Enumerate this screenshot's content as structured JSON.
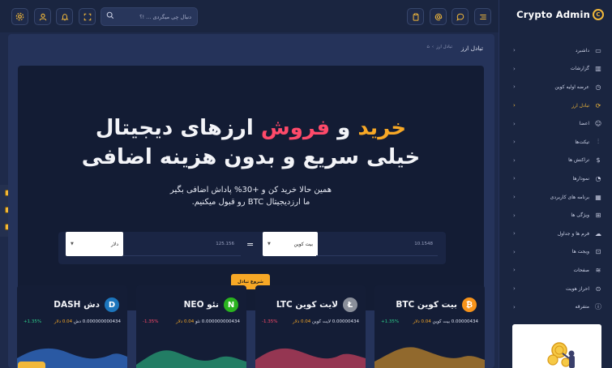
{
  "search": {
    "placeholder": "دنبال چی میگردی ... !؟"
  },
  "brand": {
    "name": "Crypto Admin",
    "logo_letter": "C"
  },
  "nav": [
    {
      "label": "داشبرد",
      "icon": "monitor-icon"
    },
    {
      "label": "گزارشات",
      "icon": "chart-icon"
    },
    {
      "label": "عرضه اولیه کوین",
      "icon": "clock-icon"
    },
    {
      "label": "تبادل ارز",
      "icon": "refresh-icon",
      "active": true
    },
    {
      "label": "اعضا",
      "icon": "users-icon"
    },
    {
      "label": "تیکت‌ها",
      "icon": "tune-icon"
    },
    {
      "label": "تراکنش ها",
      "icon": "dollar-icon"
    },
    {
      "label": "نمودارها",
      "icon": "pie-icon"
    },
    {
      "label": "برنامه های کاربردی",
      "icon": "grid-icon"
    },
    {
      "label": "ویژگی ها",
      "icon": "gift-icon"
    },
    {
      "label": "فرم ها و جداول",
      "icon": "cloud-icon"
    },
    {
      "label": "ویجت ها",
      "icon": "cast-icon"
    },
    {
      "label": "صفحات",
      "icon": "layers-icon"
    },
    {
      "label": "احراز هویت",
      "icon": "lock-icon"
    },
    {
      "label": "متفرقه",
      "icon": "info-icon"
    }
  ],
  "page": {
    "title": "تبادل ارز",
    "breadcrumb_current": "تبادل ارز"
  },
  "hero": {
    "buy": "خرید",
    "and": "و",
    "sell": "فروش",
    "line1_rest": "ارزهای دیجیتال",
    "line2": "خیلی سریع و بدون هزینه اضافی",
    "sub1": "همین حالا خرید کن و +30% پاداش اضافی بگیر",
    "sub2": "ما ارزدیجیتال BTC رو قبول میکنیم."
  },
  "converter": {
    "from_amount": "10.1548",
    "from_currency": "بیت کوین",
    "equals": "=",
    "to_amount": "125.156",
    "to_currency": "دلار",
    "start_label": "شروع تبادل"
  },
  "coins": [
    {
      "name": "بیت کوین BTC",
      "symbol": "₿",
      "color": "#f7931a",
      "amount_text": "0.00000434 بیت کوین",
      "usd_text": "0.04 دلار",
      "change": "+1.35%",
      "direction": "up"
    },
    {
      "name": "لایت کوین LTC",
      "symbol": "Ł",
      "color": "#8a8f9a",
      "amount_text": "0.00000434 لایت کوین",
      "usd_text": "0.04 دلار",
      "change": "-1.35%",
      "direction": "down"
    },
    {
      "name": "نئو NEO",
      "symbol": "N",
      "color": "#2ab31f",
      "amount_text": "0.000000000434 نئو",
      "usd_text": "0.04 دلار",
      "change": "-1.35%",
      "direction": "down"
    },
    {
      "name": "دش DASH",
      "symbol": "D",
      "color": "#1c75bc",
      "amount_text": "0.000000000434 دش",
      "usd_text": "0.04 دلار",
      "change": "+1.35%",
      "direction": "up"
    }
  ],
  "colors": {
    "accent": "#f7a826",
    "sell": "#ff4a6a",
    "bg": "#1e2a4a",
    "panel": "#131c34"
  }
}
